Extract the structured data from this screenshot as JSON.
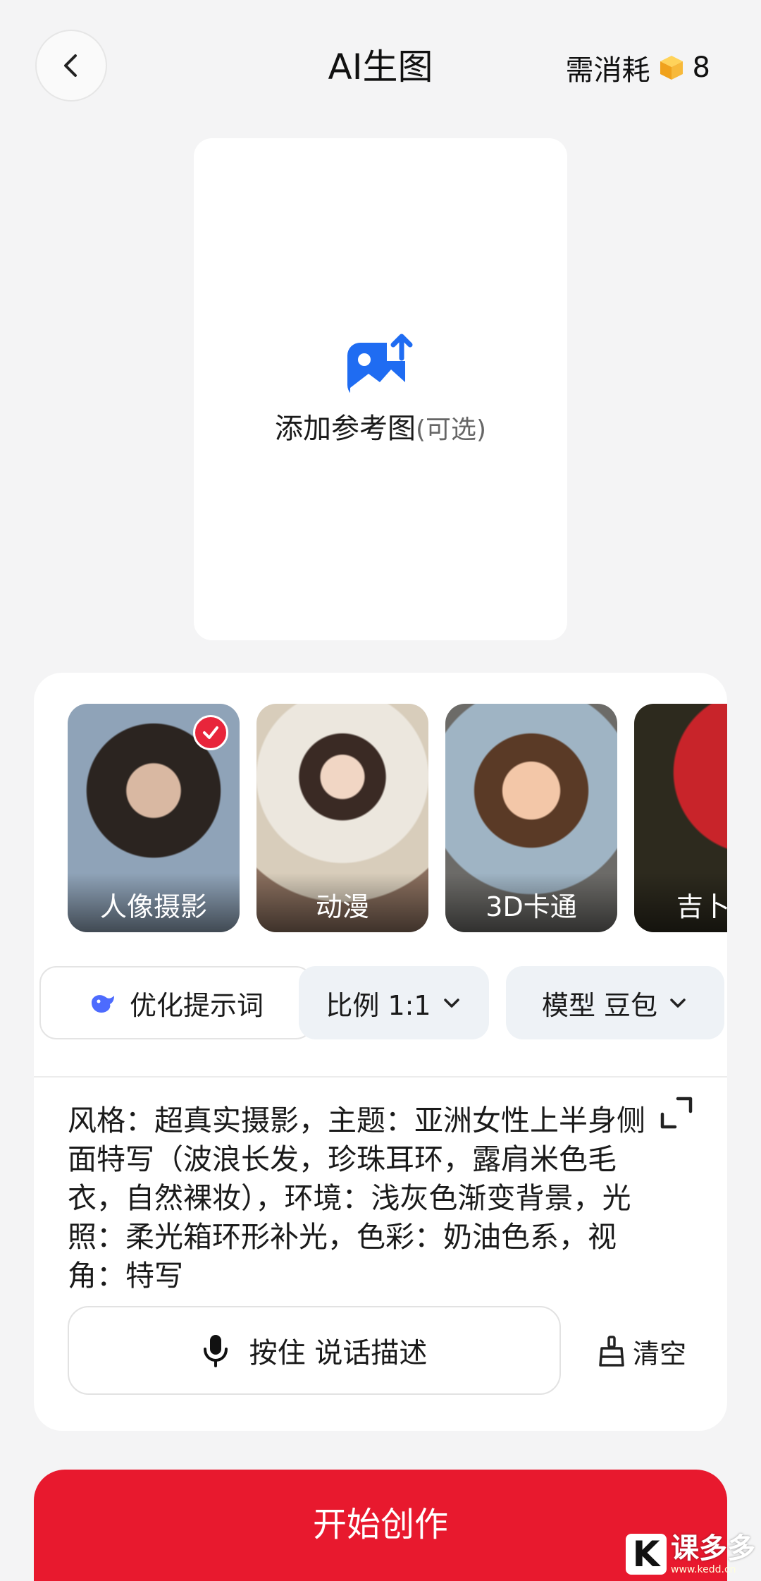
{
  "header": {
    "title": "AI生图",
    "cost_label": "需消耗",
    "cost_value": "8",
    "back_icon": "chevron-left-icon",
    "cost_icon": "gold-cube-icon"
  },
  "reference": {
    "label": "添加参考图",
    "optional": "(可选)",
    "icon": "image-upload-icon",
    "icon_color": "#1f6cf2"
  },
  "styles": [
    {
      "label": "人像摄影",
      "selected": true
    },
    {
      "label": "动漫",
      "selected": false
    },
    {
      "label": "3D卡通",
      "selected": false
    },
    {
      "label": "吉卜",
      "selected": false
    }
  ],
  "options": {
    "optimize_label": "优化提示词",
    "ratio_label": "比例 1:1",
    "model_label": "模型 豆包"
  },
  "prompt": {
    "text": "风格：超真实摄影，主题：亚洲女性上半身侧面特写（波浪长发，珍珠耳环，露肩米色毛衣，自然裸妆），环境：浅灰色渐变背景，光照：柔光箱环形补光，色彩：奶油色系，视角：特写"
  },
  "voice": {
    "label": "按住 说话描述"
  },
  "clear": {
    "label": "清空"
  },
  "start": {
    "label": "开始创作"
  },
  "watermark": {
    "brand": "课多多",
    "url": "www.kedd.cn"
  },
  "colors": {
    "accent": "#e8192e",
    "check": "#e8253b",
    "chip_bg": "#eef2f6"
  }
}
